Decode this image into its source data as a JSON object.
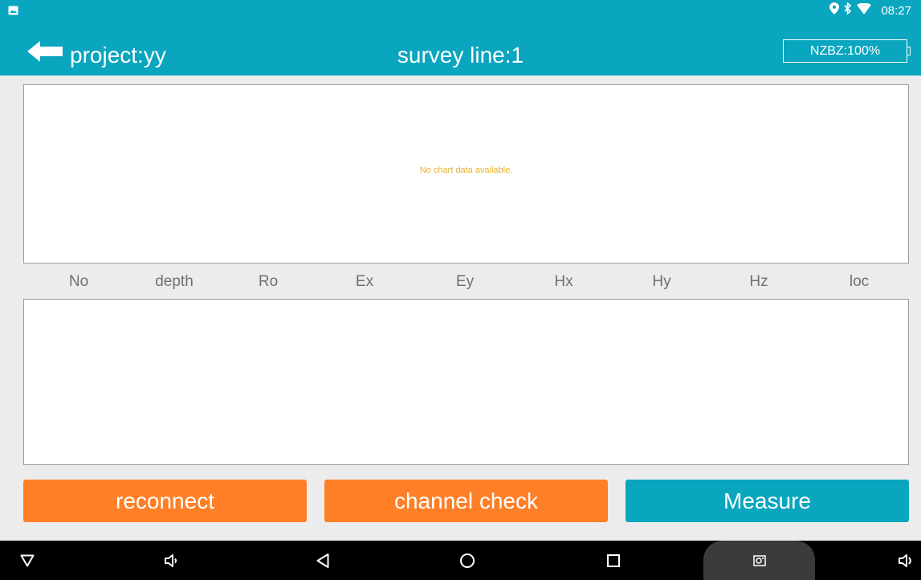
{
  "status_bar": {
    "time": "08:27",
    "icons": [
      "gallery-icon",
      "location-icon",
      "bluetooth-icon",
      "wifi-icon"
    ]
  },
  "app_bar": {
    "project_label": "project:yy",
    "survey_label": "survey line:1",
    "battery_label": "NZBZ:100%",
    "color": "#0aa5be"
  },
  "chart": {
    "empty_message": "No chart data available."
  },
  "table": {
    "columns": [
      "No",
      "depth",
      "Ro",
      "Ex",
      "Ey",
      "Hx",
      "Hy",
      "Hz",
      "loc"
    ],
    "rows": []
  },
  "buttons": {
    "reconnect": "reconnect",
    "channel_check": "channel check",
    "measure": "Measure"
  },
  "colors": {
    "accent": "#0aa5be",
    "action": "#ff7f27",
    "empty_text": "#e8b030"
  },
  "nav_bar": {
    "icons": [
      "hide-nav-icon",
      "volume-down-icon",
      "back-icon",
      "home-icon",
      "recents-icon",
      "screenshot-icon",
      "volume-up-icon"
    ]
  }
}
